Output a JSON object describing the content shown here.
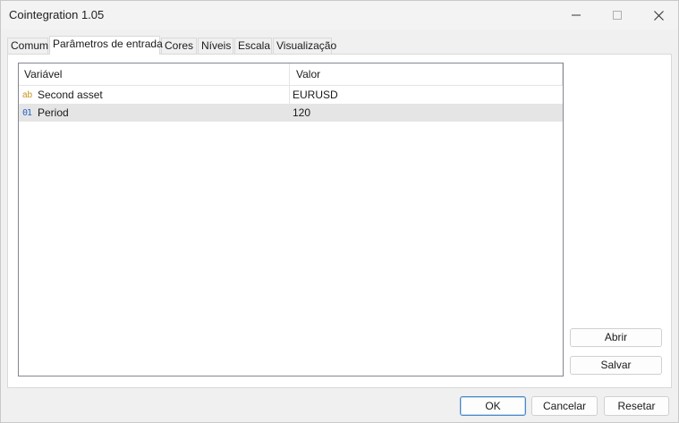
{
  "window": {
    "title": "Cointegration 1.05"
  },
  "tabs": [
    {
      "label": "Comum",
      "active": false
    },
    {
      "label": "Parâmetros de entrada",
      "active": true
    },
    {
      "label": "Cores",
      "active": false
    },
    {
      "label": "Níveis",
      "active": false
    },
    {
      "label": "Escala",
      "active": false
    },
    {
      "label": "Visualização",
      "active": false
    }
  ],
  "grid": {
    "columns": [
      "Variável",
      "Valor"
    ],
    "rows": [
      {
        "type_icon": "ab",
        "variable": "Second asset",
        "value": "EURUSD",
        "selected": false
      },
      {
        "type_icon": "01",
        "variable": "Period",
        "value": "120",
        "selected": true
      }
    ]
  },
  "side_buttons": {
    "open": "Abrir",
    "save": "Salvar"
  },
  "footer_buttons": {
    "ok": "OK",
    "cancel": "Cancelar",
    "reset": "Resetar"
  }
}
